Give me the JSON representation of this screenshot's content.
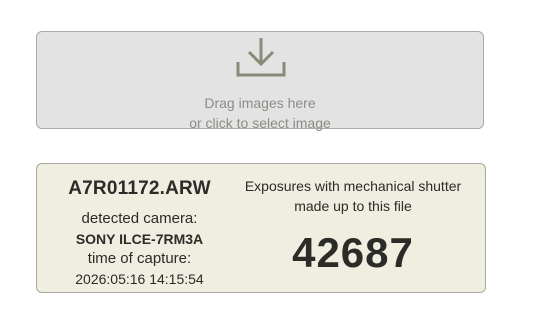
{
  "dropzone": {
    "icon": "download-icon",
    "line1": "Drag images here",
    "line2": "or click to select image"
  },
  "result": {
    "filename": "A7R01172.ARW",
    "camera_label": "detected camera:",
    "camera_model": "SONY ILCE-7RM3A",
    "capture_label": "time of capture:",
    "capture_time": "2026:05:16 14:15:54",
    "shutter_label_line1": "Exposures with mechanical shutter",
    "shutter_label_line2": "made up to this file",
    "shutter_count": "42687"
  },
  "colors": {
    "dropzone_bg": "#e3e3e3",
    "card_bg": "#efeee0",
    "icon": "#8a8a78",
    "text": "#2b2b27"
  }
}
